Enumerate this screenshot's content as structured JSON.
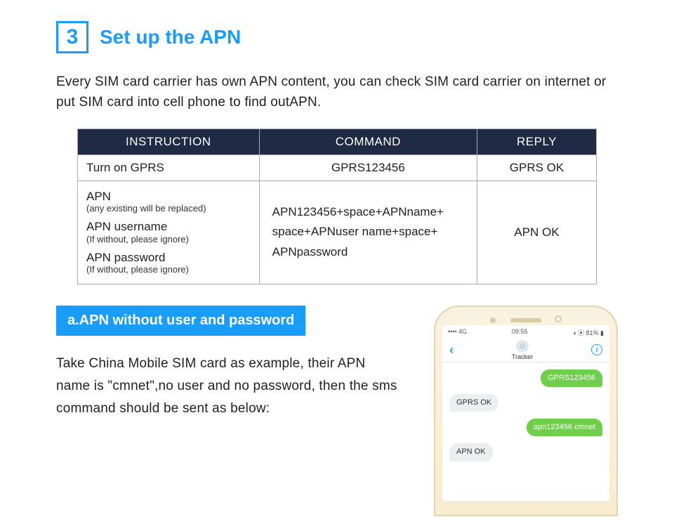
{
  "step": {
    "number": "3",
    "title": "Set up the APN"
  },
  "intro": "Every SIM card carrier has own APN content, you can check SIM card carrier on internet or put SIM card into cell phone to find outAPN.",
  "table": {
    "headers": {
      "c1": "INSTRUCTION",
      "c2": "COMMAND",
      "c3": "REPLY"
    },
    "row1": {
      "instruction": "Turn on GPRS",
      "command": "GPRS123456",
      "reply": "GPRS OK"
    },
    "row2": {
      "instr": {
        "a_main": "APN",
        "a_note": "(any existing will be replaced)",
        "b_main": "APN username",
        "b_note": "(If without, please ignore)",
        "c_main": "APN password",
        "c_note": "(If without, please ignore)"
      },
      "command_l1": "APN123456+space+APNname+",
      "command_l2": "space+APNuser name+space+",
      "command_l3": "APNpassword",
      "reply": "APN OK"
    }
  },
  "sub": {
    "heading": "a.APN without user and password",
    "text": "Take China Mobile SIM card as example, their APN name is \"cmnet\",no user and no password, then the sms command should be sent as below:"
  },
  "phone": {
    "status_left": "4G",
    "status_time": "09:55",
    "status_right": "81%",
    "contact": "Tracker",
    "info_glyph": "i",
    "messages": {
      "m1": "GPRS123456",
      "m2": "GPRS OK",
      "m3": "apn123456 cmnet",
      "m4": "APN OK"
    }
  }
}
